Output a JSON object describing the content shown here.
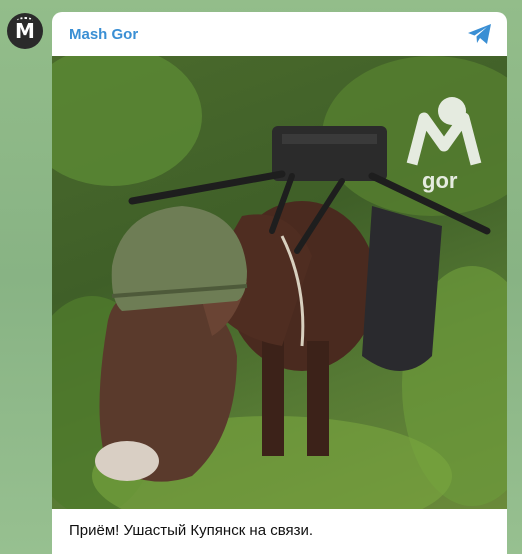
{
  "channel": {
    "name": "Mash Gor",
    "avatar_letter": "M"
  },
  "post": {
    "watermark_text": "gor",
    "caption": "Приём! Ушастый Купянск на связи."
  },
  "icons": {
    "share": "telegram-paper-plane-icon"
  },
  "colors": {
    "accent": "#3a8fd4",
    "wallpaper": "#8fb88a"
  }
}
